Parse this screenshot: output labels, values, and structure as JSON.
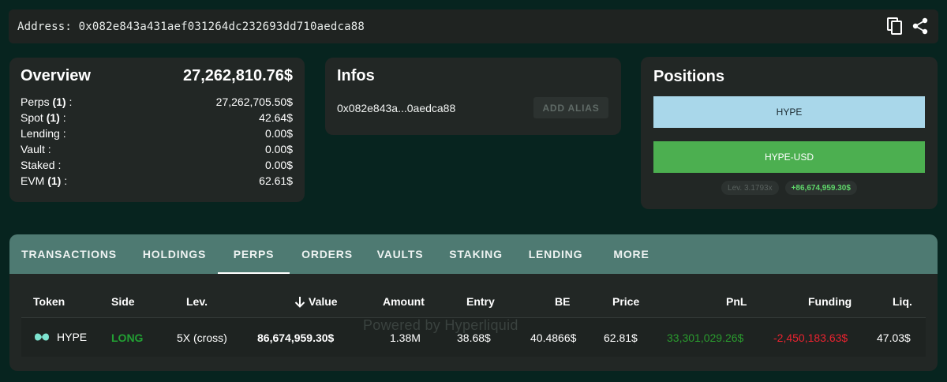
{
  "address_bar": {
    "text": "Address: 0x082e843a431aef031264dc232693dd710aedca88",
    "icons": [
      "copy-icon",
      "share-icon"
    ]
  },
  "overview": {
    "title": "Overview",
    "total": "27,262,810.76$",
    "rows": [
      {
        "label": "Perps",
        "count": "(1)",
        "suffix": " :",
        "value": "27,262,705.50$"
      },
      {
        "label": "Spot",
        "count": "(1)",
        "suffix": " :",
        "value": "42.64$"
      },
      {
        "label": "Lending :",
        "count": "",
        "suffix": "",
        "value": "0.00$"
      },
      {
        "label": "Vault :",
        "count": "",
        "suffix": "",
        "value": "0.00$"
      },
      {
        "label": "Staked :",
        "count": "",
        "suffix": "",
        "value": "0.00$"
      },
      {
        "label": "EVM",
        "count": "(1)",
        "suffix": " :",
        "value": "62.61$"
      }
    ]
  },
  "infos": {
    "title": "Infos",
    "short_address": "0x082e843a...0aedca88",
    "alias_button": "ADD ALIAS"
  },
  "positions": {
    "title": "Positions",
    "buttons": [
      "HYPE",
      "HYPE-USD"
    ],
    "leverage_badge": "Lev. 3.1793x",
    "pnl_badge": "+86,674,959.30$",
    "colors": {
      "hype": "#a9d7ea",
      "hype_usd": "#4caf50",
      "positive": "#5fd66a"
    }
  },
  "tabs": {
    "items": [
      "TRANSACTIONS",
      "HOLDINGS",
      "PERPS",
      "ORDERS",
      "VAULTS",
      "STAKING",
      "LENDING",
      "MORE"
    ],
    "active": "PERPS",
    "accent": "#4e7a72"
  },
  "table": {
    "headers": {
      "token": "Token",
      "side": "Side",
      "lev": "Lev.",
      "value": "Value",
      "amount": "Amount",
      "entry": "Entry",
      "be": "BE",
      "price": "Price",
      "pnl": "PnL",
      "funding": "Funding",
      "liq": "Liq."
    },
    "sort_icon": "arrow-down-icon",
    "rows": [
      {
        "token": "HYPE",
        "token_icon": "hype-logo-icon",
        "side": "LONG",
        "lev": "5X (cross)",
        "value": "86,674,959.30$",
        "amount": "1.38M",
        "entry": "38.68$",
        "be": "40.4866$",
        "price": "62.81$",
        "pnl": "33,301,029.26$",
        "funding": "-2,450,183.63$",
        "liq": "47.03$"
      }
    ],
    "colors": {
      "long": "#22a033",
      "pnl": "#2a9a2e",
      "funding": "#e8232f"
    }
  },
  "watermark": "Powered by Hyperliquid"
}
